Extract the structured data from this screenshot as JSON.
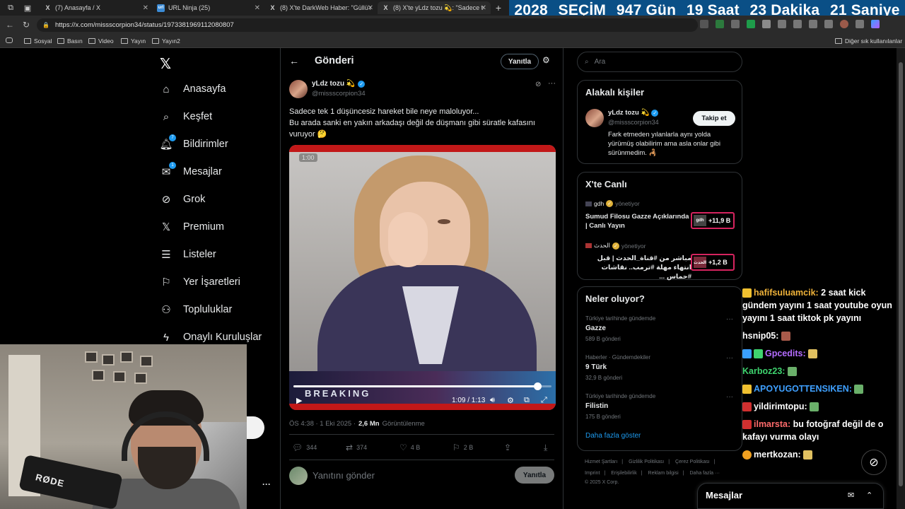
{
  "browser": {
    "tabs": [
      {
        "favicon": "X",
        "title": "(7) Anasayfa / X"
      },
      {
        "favicon": "url",
        "title": "URL Ninja (25)"
      },
      {
        "favicon": "X",
        "title": "(8) X'te DarkWeb Haber: \"Güllü'n"
      },
      {
        "favicon": "X",
        "title": "(8) X'te yLdz tozu 💫: \"Sadece tek"
      }
    ],
    "url": "https://x.com/missscorpion34/status/1973381969112080807",
    "bookmarks": [
      "Sosyal",
      "Basın",
      "Video",
      "Yayın",
      "Yayın2"
    ],
    "other_bookmarks": "Diğer sık kullanılanlar"
  },
  "countdown": {
    "year": "2028",
    "label": "SEÇİM",
    "days": "947 Gün",
    "hours": "19 Saat",
    "minutes": "23 Dakika",
    "seconds": "21 Saniye",
    "background": "#0a4f86"
  },
  "nav": {
    "items": [
      {
        "icon": "home-icon",
        "label": "Anasayfa"
      },
      {
        "icon": "search-icon",
        "label": "Keşfet"
      },
      {
        "icon": "bell-icon",
        "label": "Bildirimler",
        "badge": "7"
      },
      {
        "icon": "mail-icon",
        "label": "Mesajlar",
        "badge": "1"
      },
      {
        "icon": "grok-icon",
        "label": "Grok"
      },
      {
        "icon": "x-premium-icon",
        "label": "Premium"
      },
      {
        "icon": "list-icon",
        "label": "Listeler"
      },
      {
        "icon": "bookmark-icon",
        "label": "Yer İşaretleri"
      },
      {
        "icon": "communities-icon",
        "label": "Topluluklar"
      },
      {
        "icon": "lightning-icon",
        "label": "Onaylı Kuruluşlar"
      }
    ]
  },
  "post": {
    "header_title": "Gönderi",
    "reply_button": "Yanıtla",
    "author_name": "yLdz tozu 💫",
    "author_handle": "@missscorpion34",
    "text_line1": "Sadece tek 1 düşüncesiz hareket bile neye maloluyor...",
    "text_line2": "Bu arada sanki en yakın arkadaşı değil de düşmanı gibi süratle kafasını vuruyor 🤔",
    "video_badge": "1:00",
    "video_banner": "BREAKING",
    "video_time": "1:09 / 1:13",
    "video_progress": 0.945,
    "timestamp": "ÖS 4:38 · 1 Eki 2025 ·",
    "views_count": "2,6 Mn",
    "views_label": "Görüntülenme",
    "replies": "344",
    "reposts": "374",
    "likes": "4 B",
    "bookmarks": "2 B",
    "reply_placeholder": "Yanıtını gönder",
    "reply_submit": "Yanıtla"
  },
  "sidebar": {
    "search_placeholder": "Ara",
    "related_title": "Alakalı kişiler",
    "related_person": {
      "name": "yLdz tozu 💫",
      "handle": "@missscorpion34",
      "bio": "Fark etmeden yılanlarla aynı yolda yürümüş olabilirim ama asla onlar gibi sürünmedim. 🦂",
      "follow": "Takip et"
    },
    "live_title": "X'te Canlı",
    "live": [
      {
        "user": "gdh",
        "role": "yönetiyor",
        "title": "Sumud Filosu Gazze Açıklarında | Canlı Yayın",
        "thumb": "gdh",
        "count": "+11,9 B"
      },
      {
        "user": "الحدث",
        "role": "yönetiyor",
        "title": "مباشر من #قناة_الحدث | قبل انتهاء مهلة #ترمب.. نقاشات #حماس ...",
        "thumb": "الحدث",
        "count": "+1,2 B"
      }
    ],
    "trends_title": "Neler oluyor?",
    "trends": [
      {
        "category": "Türkiye tarihinde gündemde",
        "name": "Gazze",
        "count": "589 B gönderi"
      },
      {
        "category": "Haberler · Gündemdekiler",
        "name": "9 Türk",
        "count": "32,9 B gönderi"
      },
      {
        "category": "Türkiye tarihinde gündemde",
        "name": "Filistin",
        "count": "175 B gönderi"
      }
    ],
    "show_more": "Daha fazla göster",
    "footer_line1": [
      "Hizmet Şartları",
      "|",
      "Gizlilik Politikası",
      "|",
      "Çerez Politikası",
      "|"
    ],
    "footer_line2": [
      "Imprint",
      "|",
      "Erişilebilirlik",
      "|",
      "Reklam bilgisi",
      "|",
      "Daha fazla ···"
    ],
    "footer_line3": "© 2025 X Corp."
  },
  "chat": [
    {
      "user": "hafifsuluamcik:",
      "msg": "2 saat kick gündem yayını 1 saat youtube oyun yayını 1 saat tiktok pk yayını",
      "color": "#f0b33a"
    },
    {
      "user": "hsnip05:",
      "msg": "",
      "color": "#ffffff"
    },
    {
      "user": "Gpcedits:",
      "msg": "",
      "color": "#b46cff"
    },
    {
      "user": "Karboz23:",
      "msg": "",
      "color": "#3ed36e"
    },
    {
      "user": "APOYUGOTTENSIKEN:",
      "msg": "",
      "color": "#3fa0ff"
    },
    {
      "user": "yildirimtopu:",
      "msg": "",
      "color": "#ffffff"
    },
    {
      "user": "ilmarsta:",
      "msg": "bu fotoğraf değil de o kafayı vurma olayı",
      "color": "#ff6b6b"
    },
    {
      "user": "mertkozan:",
      "msg": "",
      "color": "#ffffff"
    }
  ],
  "messages_drawer": {
    "title": "Mesajlar"
  }
}
